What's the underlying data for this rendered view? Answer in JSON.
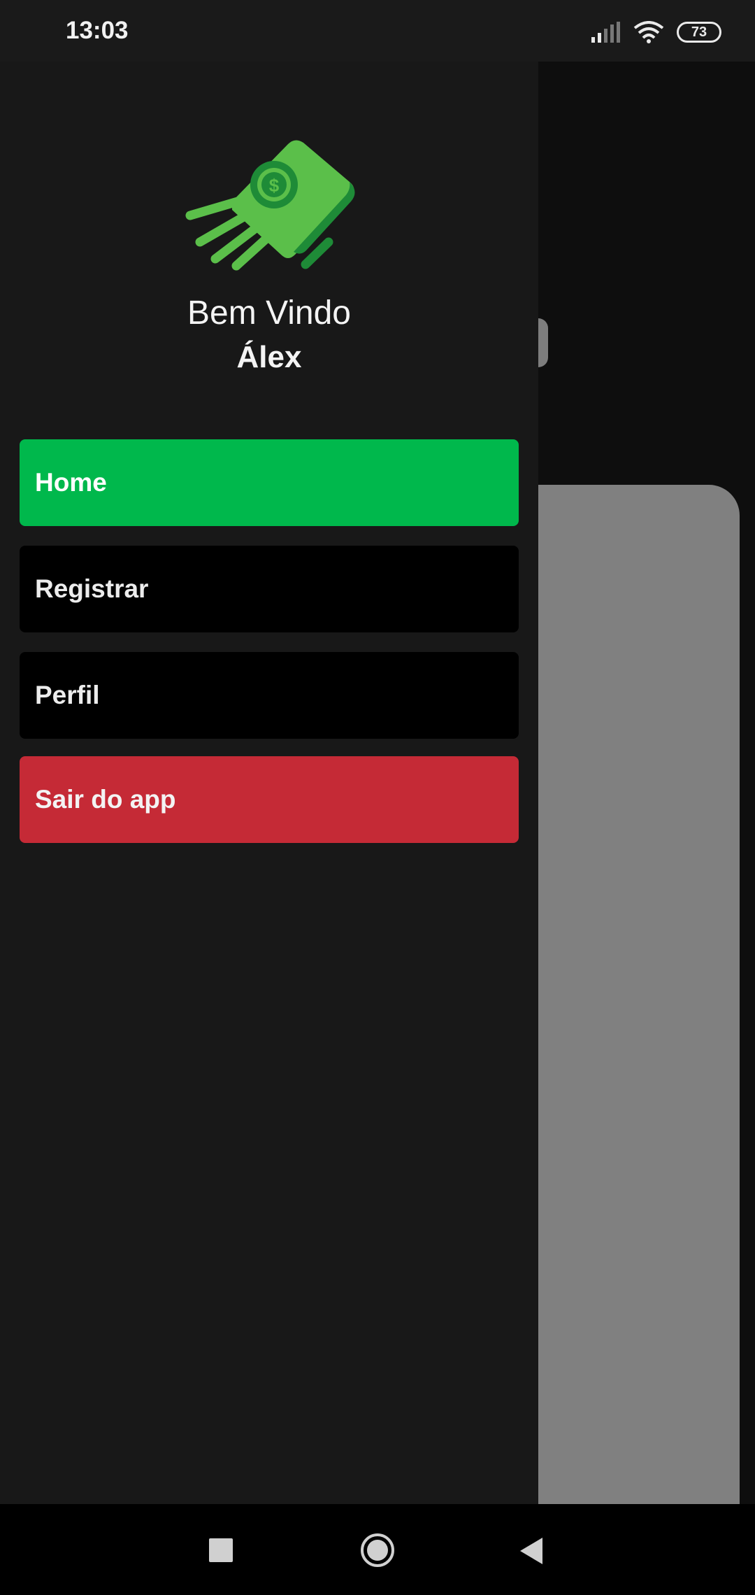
{
  "status": {
    "time": "13:03",
    "battery": "73"
  },
  "drawer": {
    "welcome_title": "Bem Vindo",
    "user_name": "Álex",
    "menu": [
      {
        "label": "Home",
        "color": "#00b84c"
      },
      {
        "label": "Registrar",
        "color": "#000000"
      },
      {
        "label": "Perfil",
        "color": "#000000"
      },
      {
        "label": "Sair do app",
        "color": "#c52a36"
      }
    ]
  },
  "icons": {
    "logo": "flying-money-icon",
    "signal": "cellular-signal-icon",
    "wifi": "wifi-icon",
    "battery": "battery-icon",
    "nav_recent": "recent-apps-icon",
    "nav_home": "home-circle-icon",
    "nav_back": "back-triangle-icon"
  }
}
